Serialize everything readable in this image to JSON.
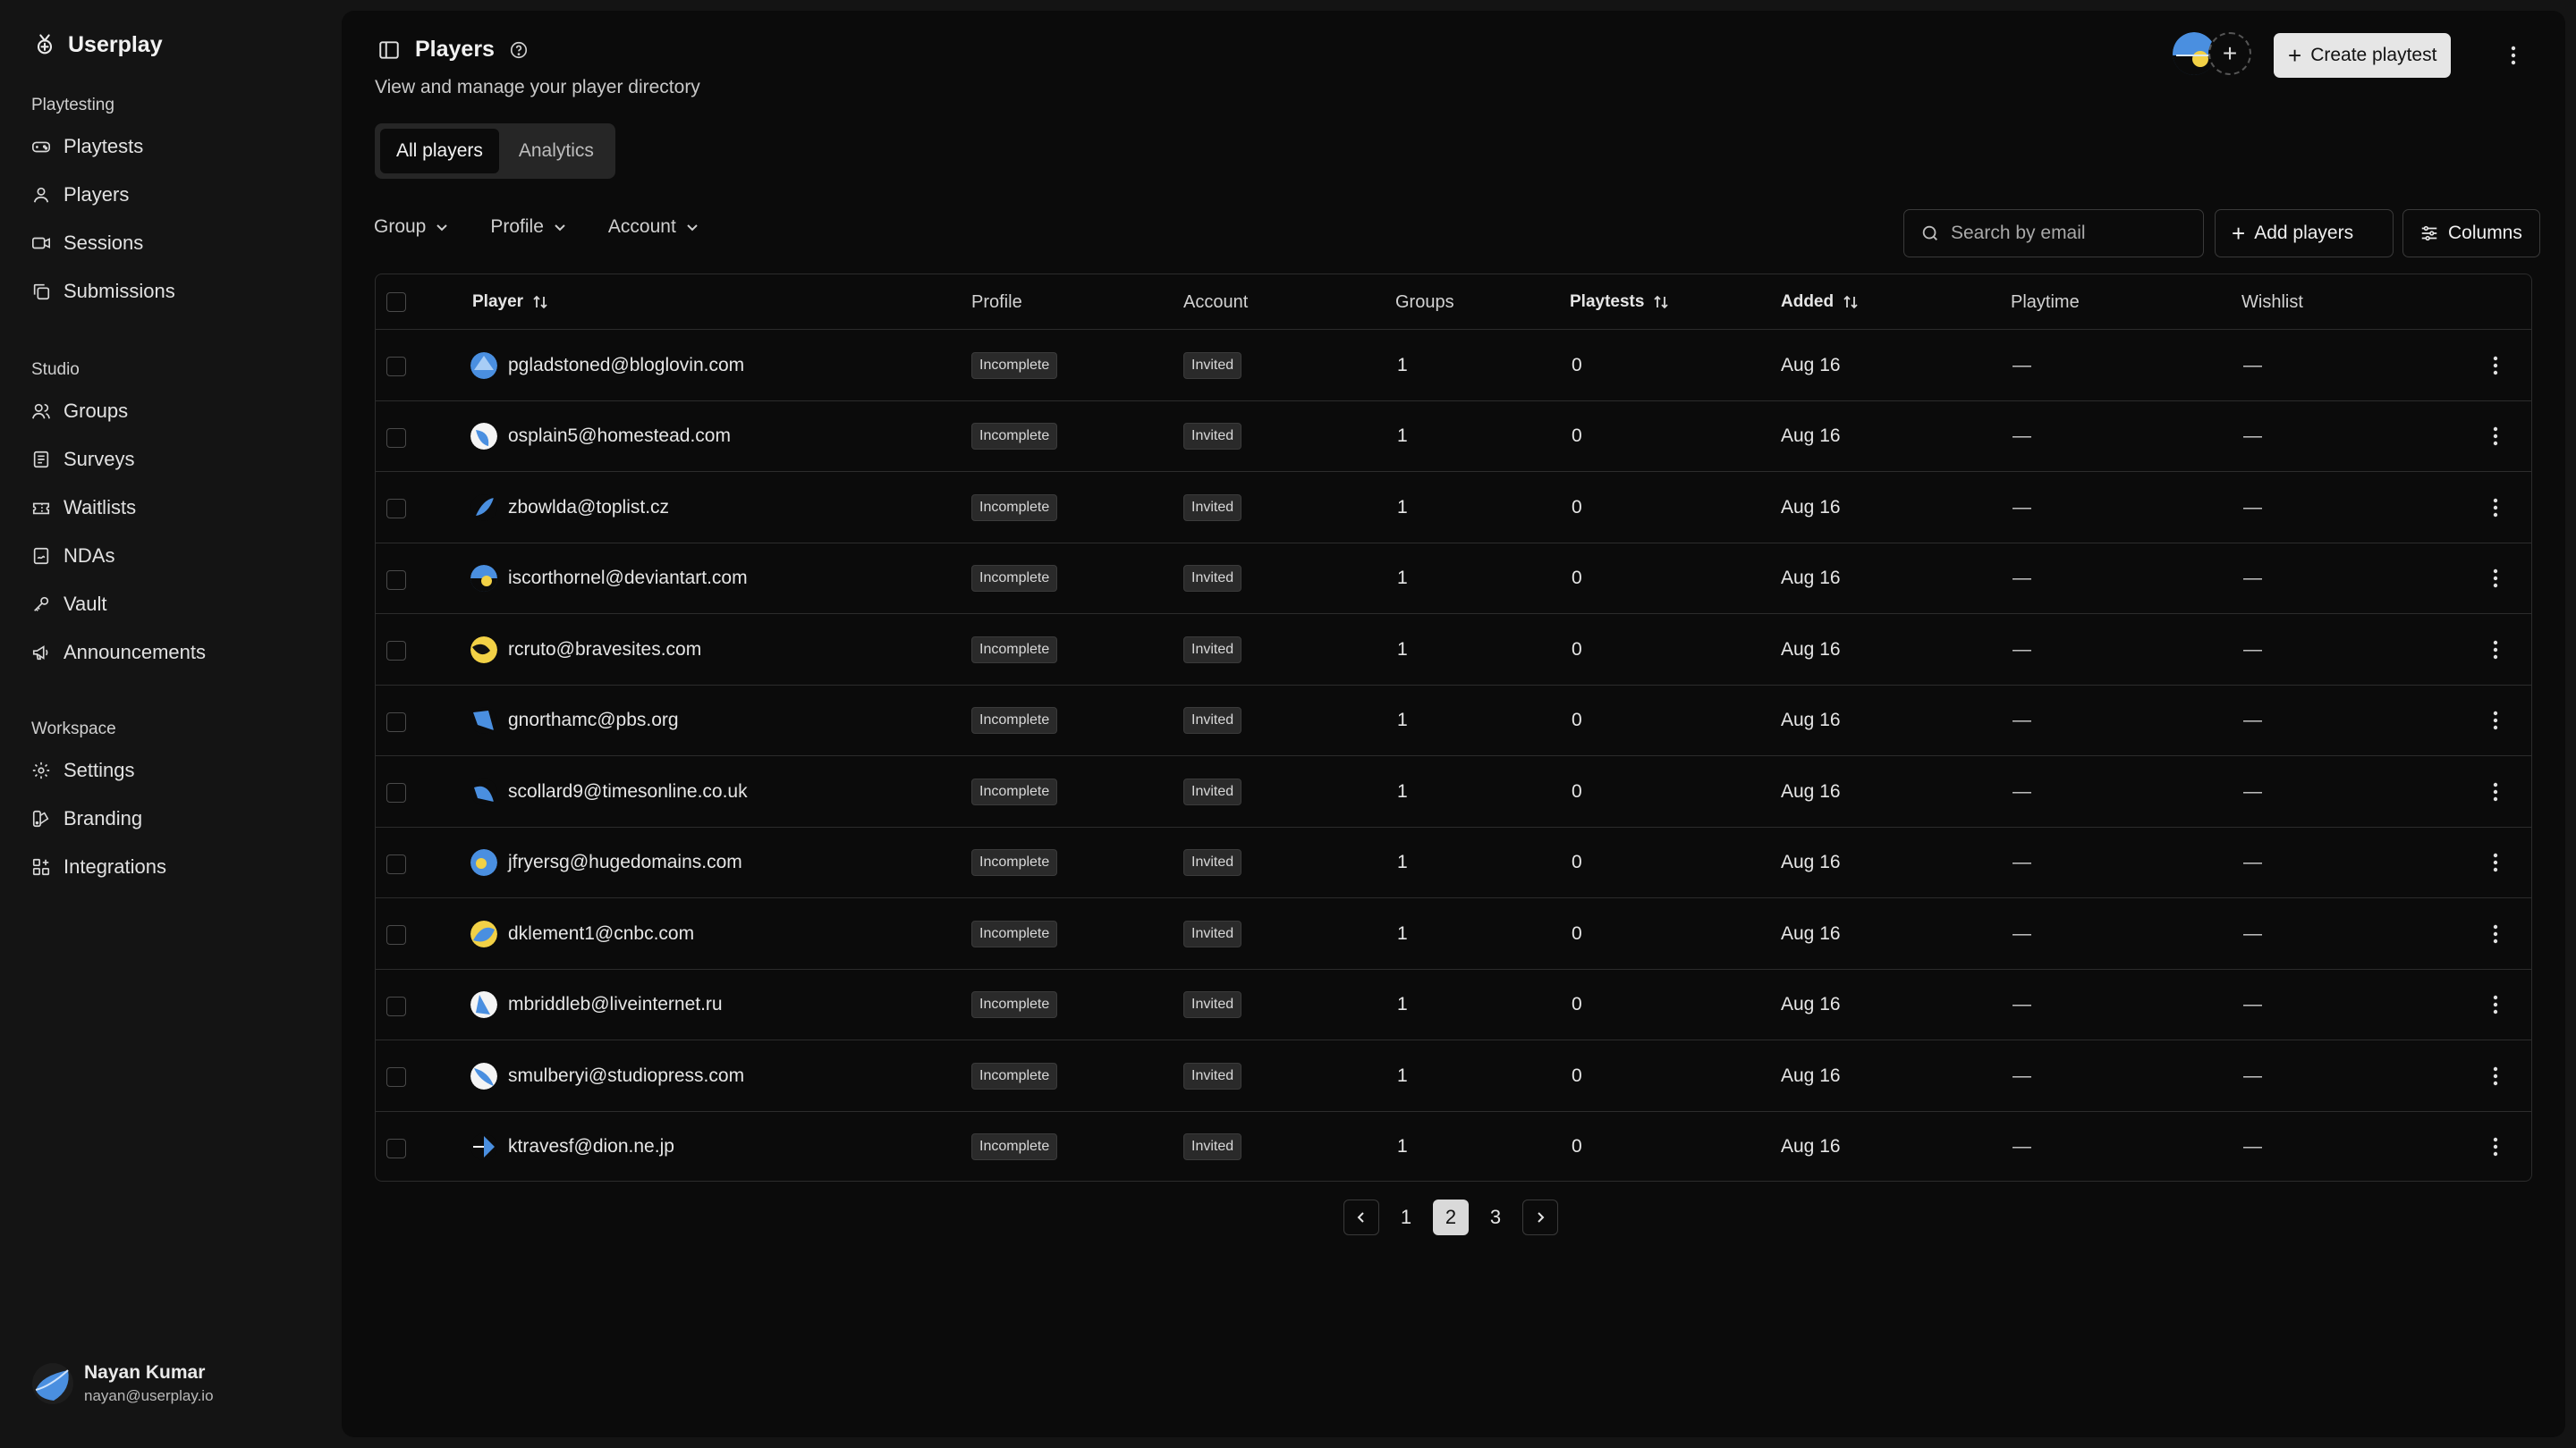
{
  "app": {
    "name": "Userplay"
  },
  "sidebar": {
    "sections": [
      {
        "title": "Playtesting",
        "items": [
          {
            "label": "Playtests",
            "icon": "gamepad-icon"
          },
          {
            "label": "Players",
            "icon": "user-icon"
          },
          {
            "label": "Sessions",
            "icon": "video-icon"
          },
          {
            "label": "Submissions",
            "icon": "copy-icon"
          }
        ]
      },
      {
        "title": "Studio",
        "items": [
          {
            "label": "Groups",
            "icon": "users-icon"
          },
          {
            "label": "Surveys",
            "icon": "survey-icon"
          },
          {
            "label": "Waitlists",
            "icon": "ticket-icon"
          },
          {
            "label": "NDAs",
            "icon": "signature-icon"
          },
          {
            "label": "Vault",
            "icon": "key-icon"
          },
          {
            "label": "Announcements",
            "icon": "megaphone-icon"
          }
        ]
      },
      {
        "title": "Workspace",
        "items": [
          {
            "label": "Settings",
            "icon": "gear-icon"
          },
          {
            "label": "Branding",
            "icon": "palette-icon"
          },
          {
            "label": "Integrations",
            "icon": "grid-plus-icon"
          }
        ]
      }
    ],
    "user": {
      "name": "Nayan Kumar",
      "email": "nayan@userplay.io"
    }
  },
  "header": {
    "title": "Players",
    "subtitle": "View and manage your player directory",
    "create_label": "Create playtest",
    "add_collaborator": "+"
  },
  "tabs": [
    {
      "label": "All players",
      "active": true
    },
    {
      "label": "Analytics",
      "active": false
    }
  ],
  "filters": [
    "Group",
    "Profile",
    "Account"
  ],
  "search": {
    "placeholder": "Search by email"
  },
  "actions": {
    "add_players": "Add players",
    "columns": "Columns"
  },
  "table": {
    "columns": [
      "Player",
      "Profile",
      "Account",
      "Groups",
      "Playtests",
      "Added",
      "Playtime",
      "Wishlist"
    ],
    "rows": [
      {
        "email": "pgladstoned@bloglovin.com",
        "profile": "Incomplete",
        "account": "Invited",
        "groups": "1",
        "playtests": "0",
        "added": "Aug 16",
        "playtime": "—",
        "wishlist": "—"
      },
      {
        "email": "osplain5@homestead.com",
        "profile": "Incomplete",
        "account": "Invited",
        "groups": "1",
        "playtests": "0",
        "added": "Aug 16",
        "playtime": "—",
        "wishlist": "—"
      },
      {
        "email": "zbowlda@toplist.cz",
        "profile": "Incomplete",
        "account": "Invited",
        "groups": "1",
        "playtests": "0",
        "added": "Aug 16",
        "playtime": "—",
        "wishlist": "—"
      },
      {
        "email": "iscorthornel@deviantart.com",
        "profile": "Incomplete",
        "account": "Invited",
        "groups": "1",
        "playtests": "0",
        "added": "Aug 16",
        "playtime": "—",
        "wishlist": "—"
      },
      {
        "email": "rcruto@bravesites.com",
        "profile": "Incomplete",
        "account": "Invited",
        "groups": "1",
        "playtests": "0",
        "added": "Aug 16",
        "playtime": "—",
        "wishlist": "—"
      },
      {
        "email": "gnorthamc@pbs.org",
        "profile": "Incomplete",
        "account": "Invited",
        "groups": "1",
        "playtests": "0",
        "added": "Aug 16",
        "playtime": "—",
        "wishlist": "—"
      },
      {
        "email": "scollard9@timesonline.co.uk",
        "profile": "Incomplete",
        "account": "Invited",
        "groups": "1",
        "playtests": "0",
        "added": "Aug 16",
        "playtime": "—",
        "wishlist": "—"
      },
      {
        "email": "jfryersg@hugedomains.com",
        "profile": "Incomplete",
        "account": "Invited",
        "groups": "1",
        "playtests": "0",
        "added": "Aug 16",
        "playtime": "—",
        "wishlist": "—"
      },
      {
        "email": "dklement1@cnbc.com",
        "profile": "Incomplete",
        "account": "Invited",
        "groups": "1",
        "playtests": "0",
        "added": "Aug 16",
        "playtime": "—",
        "wishlist": "—"
      },
      {
        "email": "mbriddleb@liveinternet.ru",
        "profile": "Incomplete",
        "account": "Invited",
        "groups": "1",
        "playtests": "0",
        "added": "Aug 16",
        "playtime": "—",
        "wishlist": "—"
      },
      {
        "email": "smulberyi@studiopress.com",
        "profile": "Incomplete",
        "account": "Invited",
        "groups": "1",
        "playtests": "0",
        "added": "Aug 16",
        "playtime": "—",
        "wishlist": "—"
      },
      {
        "email": "ktravesf@dion.ne.jp",
        "profile": "Incomplete",
        "account": "Invited",
        "groups": "1",
        "playtests": "0",
        "added": "Aug 16",
        "playtime": "—",
        "wishlist": "—"
      }
    ]
  },
  "pagination": {
    "pages": [
      "1",
      "2",
      "3"
    ],
    "current": "2"
  },
  "colors": {
    "accent_blue": "#4a8fe0",
    "accent_yellow": "#f2d146",
    "panel": "#0b0b0b",
    "sidebar": "#141414"
  }
}
